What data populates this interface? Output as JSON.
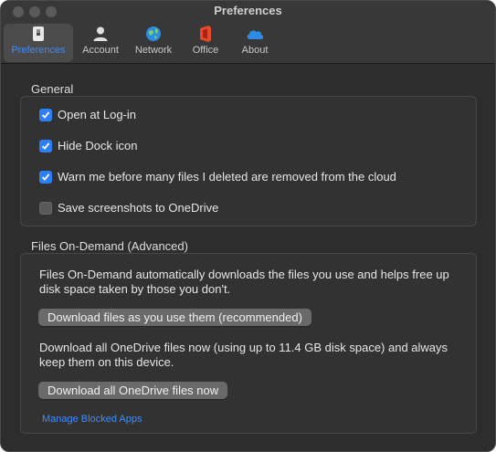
{
  "window": {
    "title": "Preferences"
  },
  "tabs": [
    {
      "label": "Preferences",
      "icon": "preferences-switch-icon",
      "active": true
    },
    {
      "label": "Account",
      "icon": "person-icon",
      "active": false
    },
    {
      "label": "Network",
      "icon": "globe-network-icon",
      "active": false
    },
    {
      "label": "Office",
      "icon": "office-logo-icon",
      "active": false
    },
    {
      "label": "About",
      "icon": "onedrive-cloud-icon",
      "active": false
    }
  ],
  "general": {
    "title": "General",
    "options": [
      {
        "label": "Open at Log-in",
        "checked": true
      },
      {
        "label": "Hide Dock icon",
        "checked": true
      },
      {
        "label": "Warn me before many files I deleted are removed from the cloud",
        "checked": true
      },
      {
        "label": "Save screenshots to OneDrive",
        "checked": false
      }
    ]
  },
  "files_on_demand": {
    "title": "Files On-Demand (Advanced)",
    "description": "Files On-Demand automatically downloads the files you use and helps free up disk space taken by those you don't.",
    "download_as_used_button": "Download files as you use them (recommended)",
    "download_all_description": "Download all OneDrive files now (using up to 11.4 GB disk space) and always keep them on this device.",
    "download_all_button": "Download all OneDrive files now",
    "manage_link": "Manage Blocked Apps"
  },
  "colors": {
    "accent": "#2c7ff7",
    "link": "#3d8cff",
    "background": "#2d2d2d"
  }
}
